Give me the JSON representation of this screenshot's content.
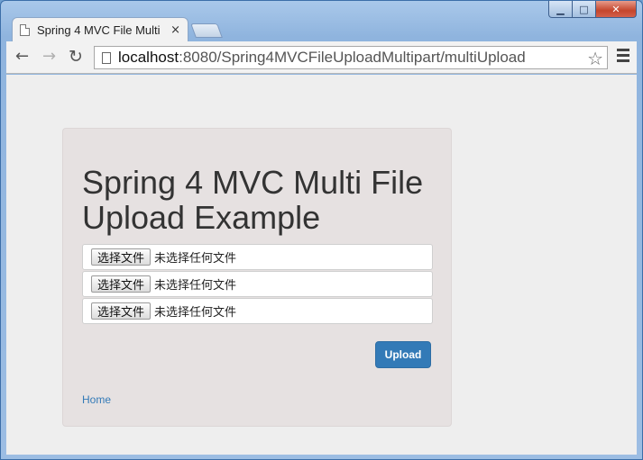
{
  "browser": {
    "tab_title": "Spring 4 MVC File Multi",
    "tab_close": "×",
    "url_host": "localhost",
    "url_rest": ":8080/Spring4MVCFileUploadMultipart/multiUpload",
    "controls": {
      "minimize": "▁",
      "maximize": "□",
      "close": "✕"
    },
    "nav": {
      "back": "←",
      "forward": "→",
      "reload": "↻",
      "star": "☆"
    }
  },
  "page": {
    "heading": "Spring 4 MVC Multi File Upload Example",
    "file_inputs": [
      {
        "button_label": "选择文件",
        "status": "未选择任何文件"
      },
      {
        "button_label": "选择文件",
        "status": "未选择任何文件"
      },
      {
        "button_label": "选择文件",
        "status": "未选择任何文件"
      }
    ],
    "upload_label": "Upload",
    "home_link": "Home",
    "accent_color": "#337ab7"
  }
}
